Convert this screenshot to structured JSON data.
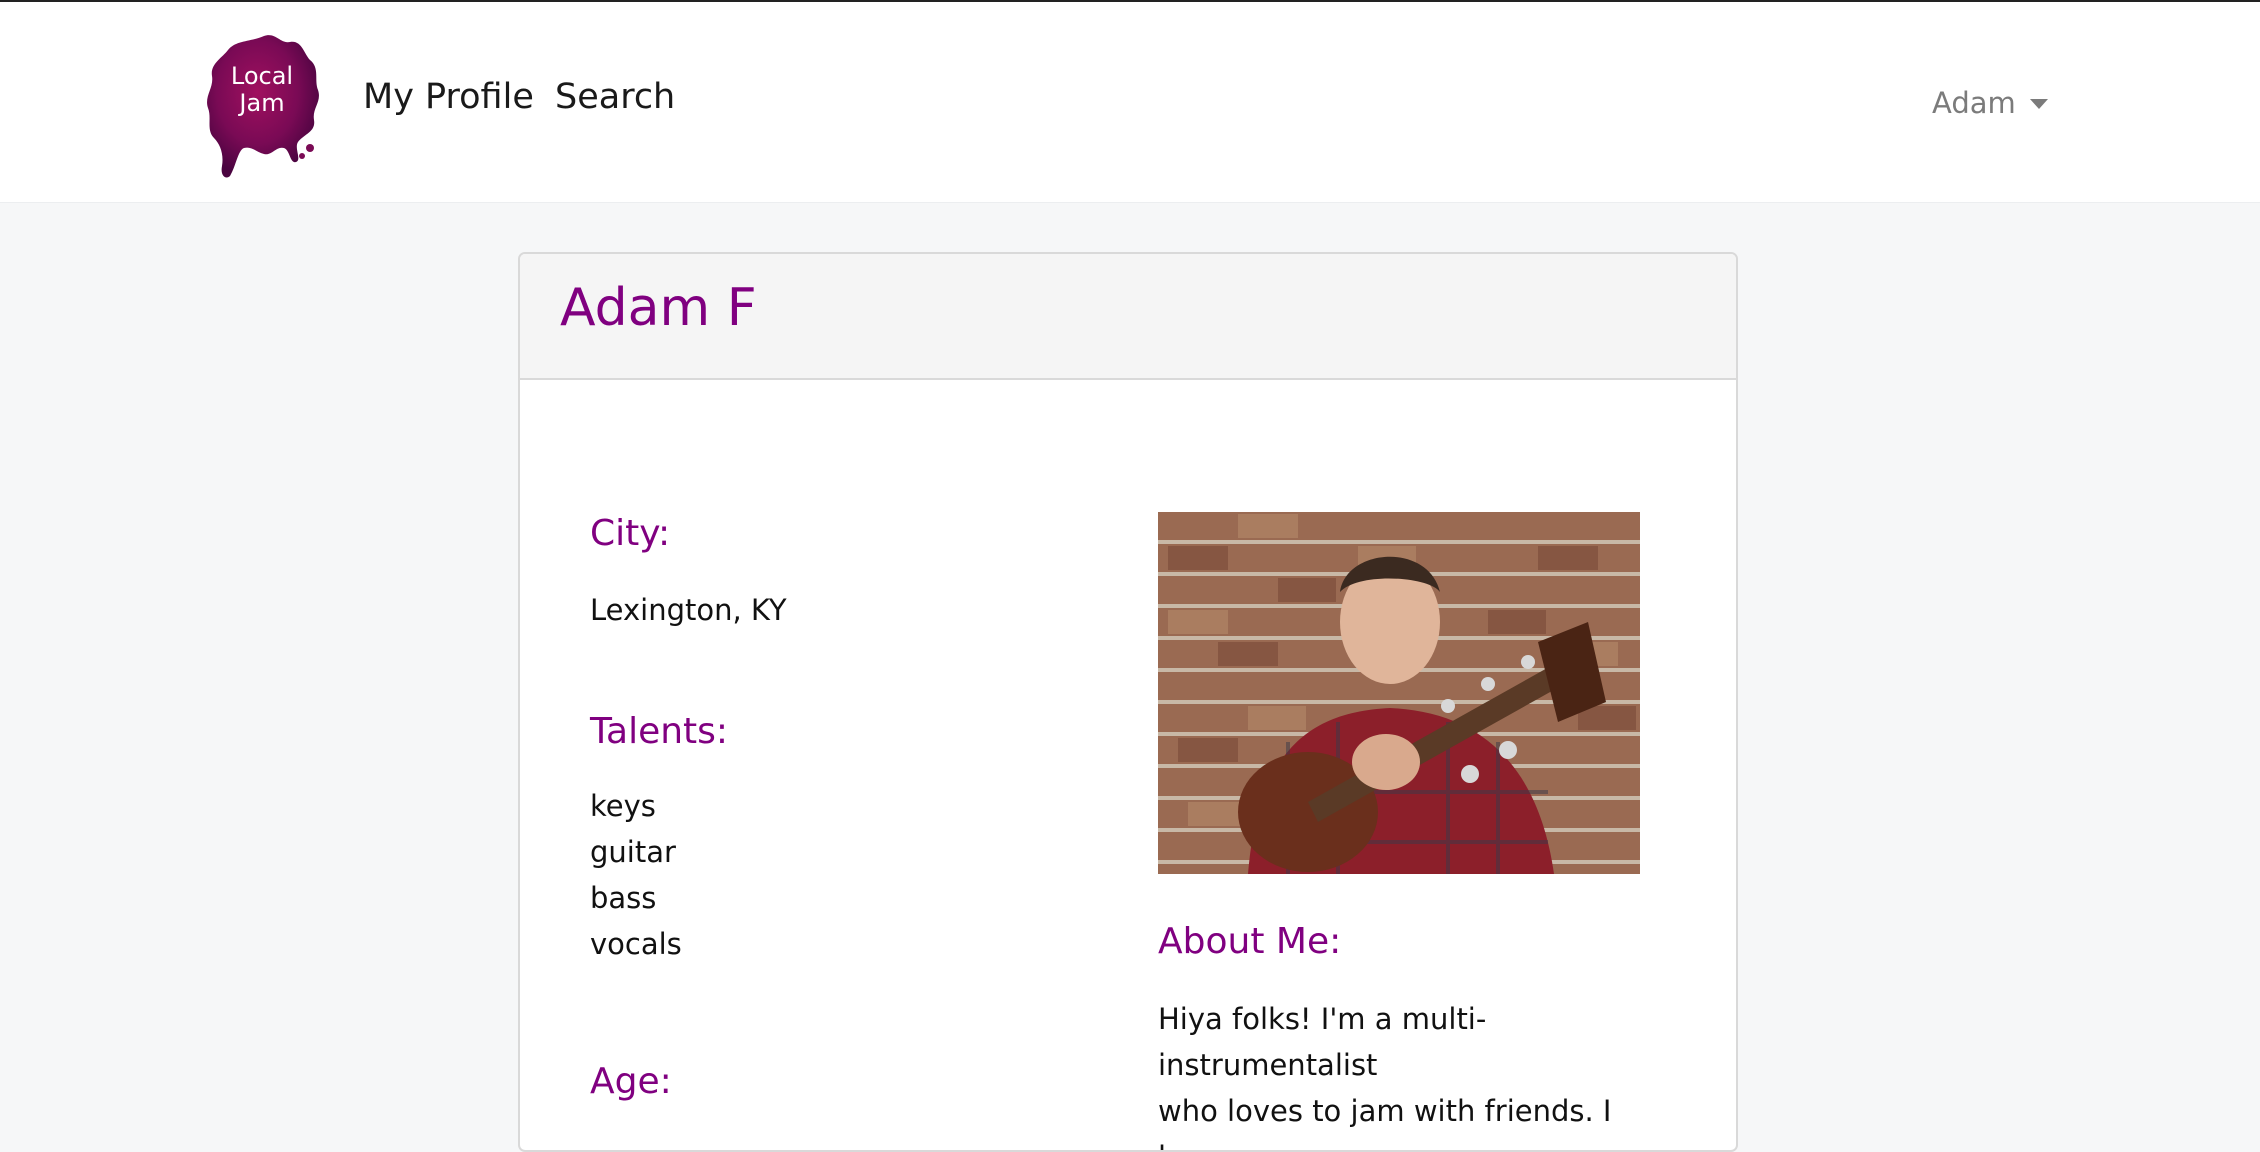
{
  "brand": {
    "logo_text_line1": "Local",
    "logo_text_line2": "Jam",
    "logo_color": "#7a0a55"
  },
  "nav": {
    "my_profile": "My Profile",
    "search": "Search"
  },
  "user_menu": {
    "label": "Adam"
  },
  "profile": {
    "name": "Adam F",
    "city_label": "City:",
    "city": "Lexington, KY",
    "talents_label": "Talents:",
    "talents": [
      "keys",
      "guitar",
      "bass",
      "vocals"
    ],
    "age_label": "Age:",
    "about_label": "About Me:",
    "about_text_line1": "Hiya folks! I'm a multi-instrumentalist",
    "about_text_line2": "who loves to jam with friends. I love"
  },
  "colors": {
    "accent": "#800080",
    "page_bg": "#f6f7f8",
    "card_header_bg": "#f5f5f5"
  }
}
